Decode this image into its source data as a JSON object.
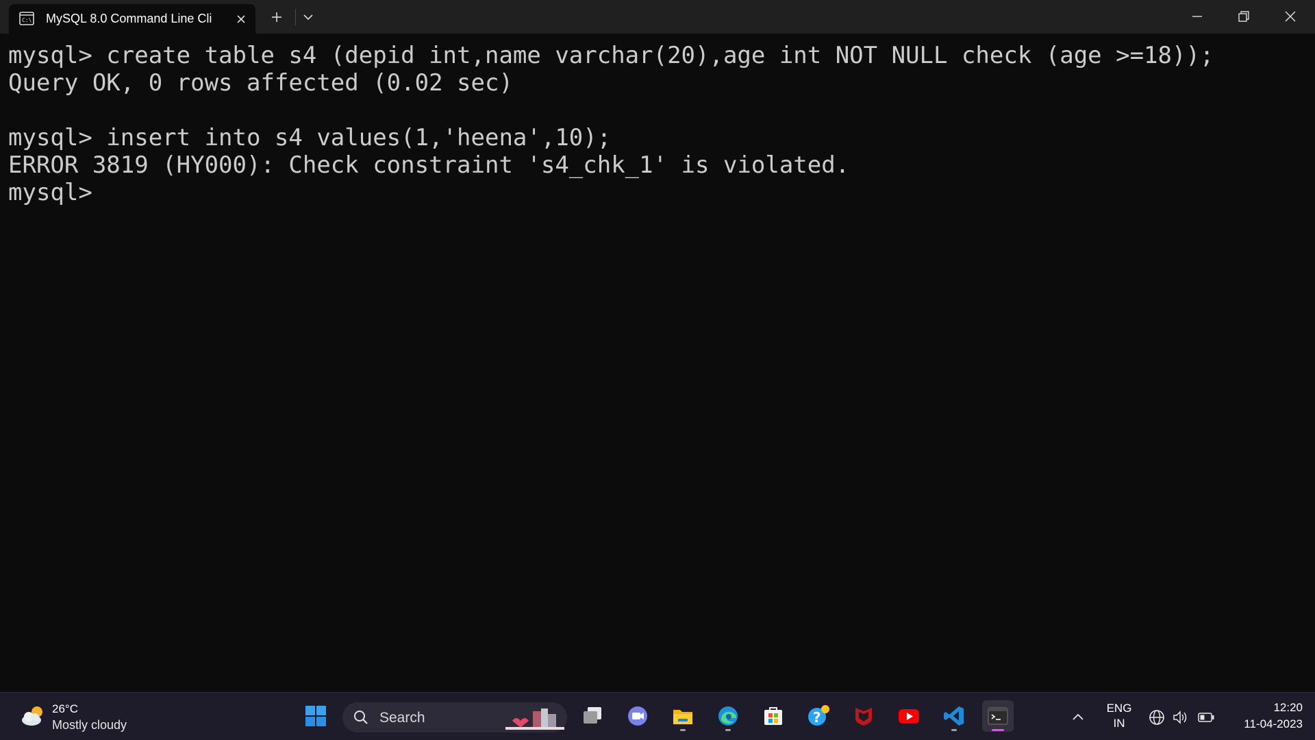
{
  "window": {
    "tab_title": "MySQL 8.0 Command Line Cli"
  },
  "terminal": {
    "lines": [
      "mysql> create table s4 (depid int,name varchar(20),age int NOT NULL check (age >=18));",
      "Query OK, 0 rows affected (0.02 sec)",
      "",
      "mysql> insert into s4 values(1,'heena',10);",
      "ERROR 3819 (HY000): Check constraint 's4_chk_1' is violated.",
      "mysql>"
    ]
  },
  "taskbar": {
    "weather": {
      "temp": "26°C",
      "desc": "Mostly cloudy",
      "icon": "cloudy-sun-icon"
    },
    "search": {
      "label": "Search"
    },
    "apps": [
      "start-icon",
      "task-view-icon",
      "teams-icon",
      "file-explorer-icon",
      "edge-icon",
      "store-icon",
      "help-icon",
      "mcafee-icon",
      "youtube-icon",
      "vscode-icon",
      "terminal-icon"
    ],
    "language": {
      "line1": "ENG",
      "line2": "IN"
    },
    "clock": {
      "time": "12:20",
      "date": "11-04-2023"
    }
  },
  "colors": {
    "terminal_bg": "#0c0c0c",
    "terminal_text": "#cccccc",
    "taskbar_bg": "#1e1c2a",
    "titlebar_bg": "#202020",
    "active_indicator": "#c95fd0"
  }
}
